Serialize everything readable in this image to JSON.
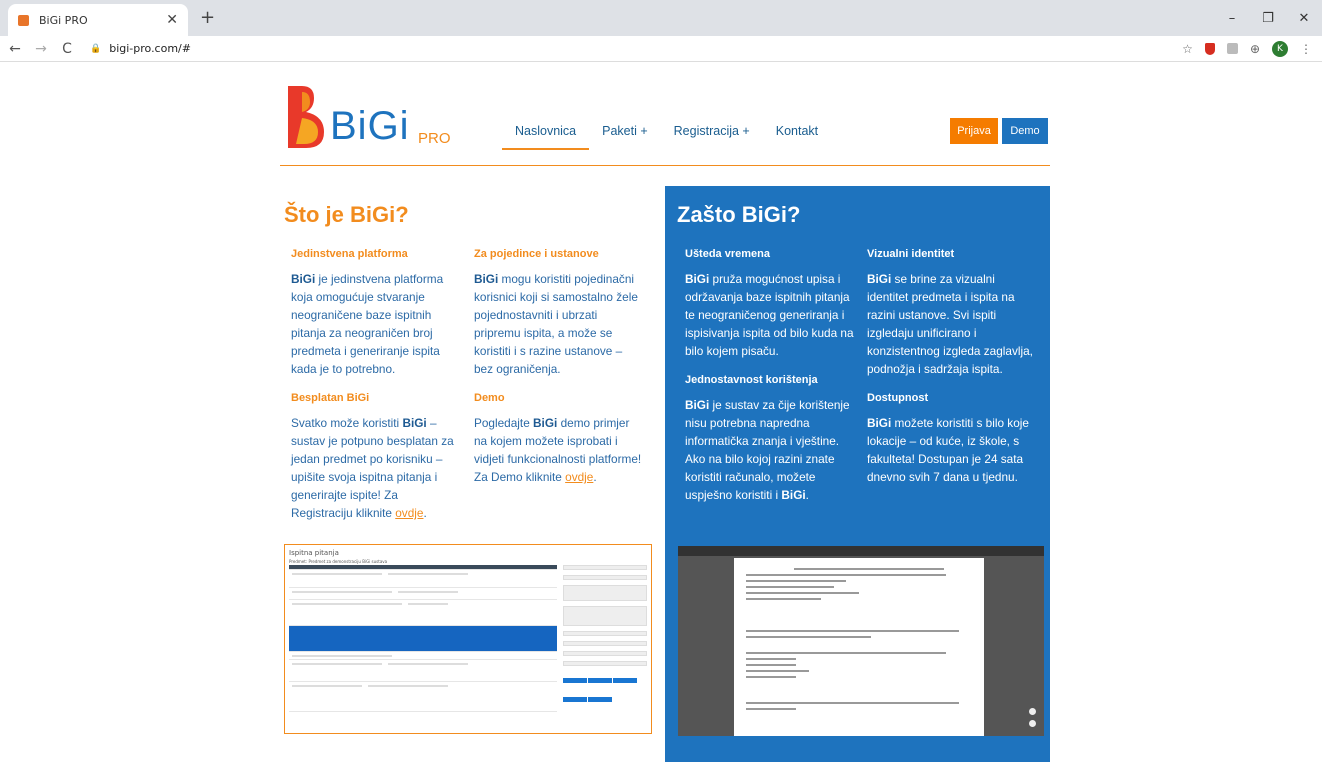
{
  "browser": {
    "tab_title": "BiGi PRO",
    "tab_close": "✕",
    "new_tab": "+",
    "url": "bigi-pro.com/#",
    "window_controls": [
      "–",
      "❐",
      "✕"
    ],
    "profile_initial": "K"
  },
  "header": {
    "logo_text": "BiGi",
    "logo_suffix": "PRO",
    "nav": [
      {
        "label": "Naslovnica"
      },
      {
        "label": "Paketi +"
      },
      {
        "label": "Registracija +"
      },
      {
        "label": "Kontakt"
      }
    ],
    "login_button": "Prijava",
    "demo_button": "Demo"
  },
  "left": {
    "title": "Što je BiGi?",
    "col1": {
      "h1": "Jedinstvena platforma",
      "p1_brand": "BiGi",
      "p1_rest": " je jedinstvena platforma koja omogućuje stvaranje neograničene baze ispitnih pitanja za neograničen broj predmeta i generiranje ispita kada je to potrebno.",
      "h2": "Besplatan BiGi",
      "p2_a": "Svatko može koristiti ",
      "p2_brand": "BiGi",
      "p2_b": " – sustav je potpuno besplatan za jedan predmet po korisniku – upišite svoja ispitna pitanja i generirajte ispite! Za Registraciju kliknite ",
      "p2_link": "ovdje",
      "p2_end": "."
    },
    "col2": {
      "h1": "Za pojedince i ustanove",
      "p1_brand": "BiGi",
      "p1_rest": " mogu koristiti pojedinačni korisnici koji si samostalno žele pojednostavniti i ubrzati pripremu ispita, a može se koristiti i s razine ustanove – bez ograničenja.",
      "h2": "Demo",
      "p2_a": "Pogledajte ",
      "p2_brand": "BiGi",
      "p2_b": " demo primjer na kojem možete isprobati i vidjeti funkcionalnosti platforme! Za Demo kliknite ",
      "p2_link": "ovdje",
      "p2_end": "."
    },
    "screenshot": {
      "title": "Ispitna pitanja",
      "subtitle": "Predmet: Predmet za demonstraciju BiGi sustava"
    }
  },
  "right": {
    "title": "Zašto BiGi?",
    "col1": {
      "h1": "Ušteda vremena",
      "p1_brand": "BiGi",
      "p1_rest": " pruža mogućnost upisa i održavanja baze ispitnih pitanja te neograničenog generiranja i ispisivanja ispita od bilo kuda na bilo kojem pisaču.",
      "h2": "Jednostavnost korištenja",
      "p2_brand": "BiGi",
      "p2_rest": " je sustav za čije korištenje nisu potrebna napredna informatička znanja i vještine. Ako na bilo kojoj razini znate koristiti računalo, možete uspješno koristiti i ",
      "p2_brand2": "BiGi",
      "p2_end": "."
    },
    "col2": {
      "h1": "Vizualni identitet",
      "p1_brand": "BiGi",
      "p1_rest": " se brine za vizualni identitet predmeta i ispita na razini ustanove. Svi ispiti izgledaju unificirano i konzistentnog izgleda zaglavlja, podnožja i sadržaja ispita.",
      "h2": "Dostupnost",
      "p2_brand": "BiGi",
      "p2_rest": " možete koristiti s bilo koje lokacije – od kuće, iz škole, s fakulteta! Dostupan je 24 sata dnevno svih 7 dana u tjednu."
    }
  },
  "colors": {
    "brand_blue": "#1e73be",
    "brand_orange": "#f28c1e"
  }
}
